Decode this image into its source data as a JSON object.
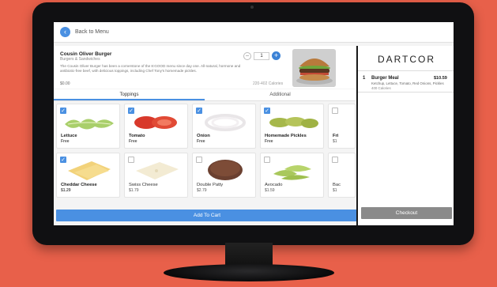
{
  "topbar": {
    "back_label": "Back to Menu"
  },
  "product": {
    "name": "Cousin Oliver Burger",
    "category": "Burgers & Sandwiches",
    "description": "The Cousin Oliver Burger has been a cornerstone of the 8:GOOD menu since day one. All-natural, hormone and antibiotic-free beef, with delicious toppings, including Chef Tony's homemade pickles.",
    "price": "$0.00",
    "calories": "220-402 Calories",
    "quantity": "1"
  },
  "tabs": [
    {
      "label": "Toppings"
    },
    {
      "label": "Additional"
    }
  ],
  "toppings": [
    {
      "name": "Lettuce",
      "price": "Free",
      "checked": true
    },
    {
      "name": "Tomato",
      "price": "Free",
      "checked": true
    },
    {
      "name": "Onion",
      "price": "Free",
      "checked": true
    },
    {
      "name": "Homemade Pickles",
      "price": "Free",
      "checked": true
    },
    {
      "name": "Fri",
      "price": "$1",
      "checked": false
    },
    {
      "name": "Cheddar Cheese",
      "price": "$1.29",
      "checked": true
    },
    {
      "name": "Swiss Cheese",
      "price": "$1.79",
      "checked": false
    },
    {
      "name": "Double Patty",
      "price": "$2.79",
      "checked": false
    },
    {
      "name": "Avocado",
      "price": "$1.59",
      "checked": false
    },
    {
      "name": "Bac",
      "price": "$1",
      "checked": false
    }
  ],
  "add_to_cart_label": "Add To Cart",
  "order": {
    "brand": "DARTCOR",
    "items": [
      {
        "qty": "1",
        "name": "Burger Meal",
        "price": "$10.59",
        "desc": "Ketchup, Lettuce, Tomato, Red Onions, Pickles",
        "calories": "400 Calories"
      }
    ],
    "checkout_label": "Checkout"
  },
  "colors": {
    "accent": "#4a90e2",
    "background": "#e8604a",
    "checkout": "#8a8a8a"
  }
}
